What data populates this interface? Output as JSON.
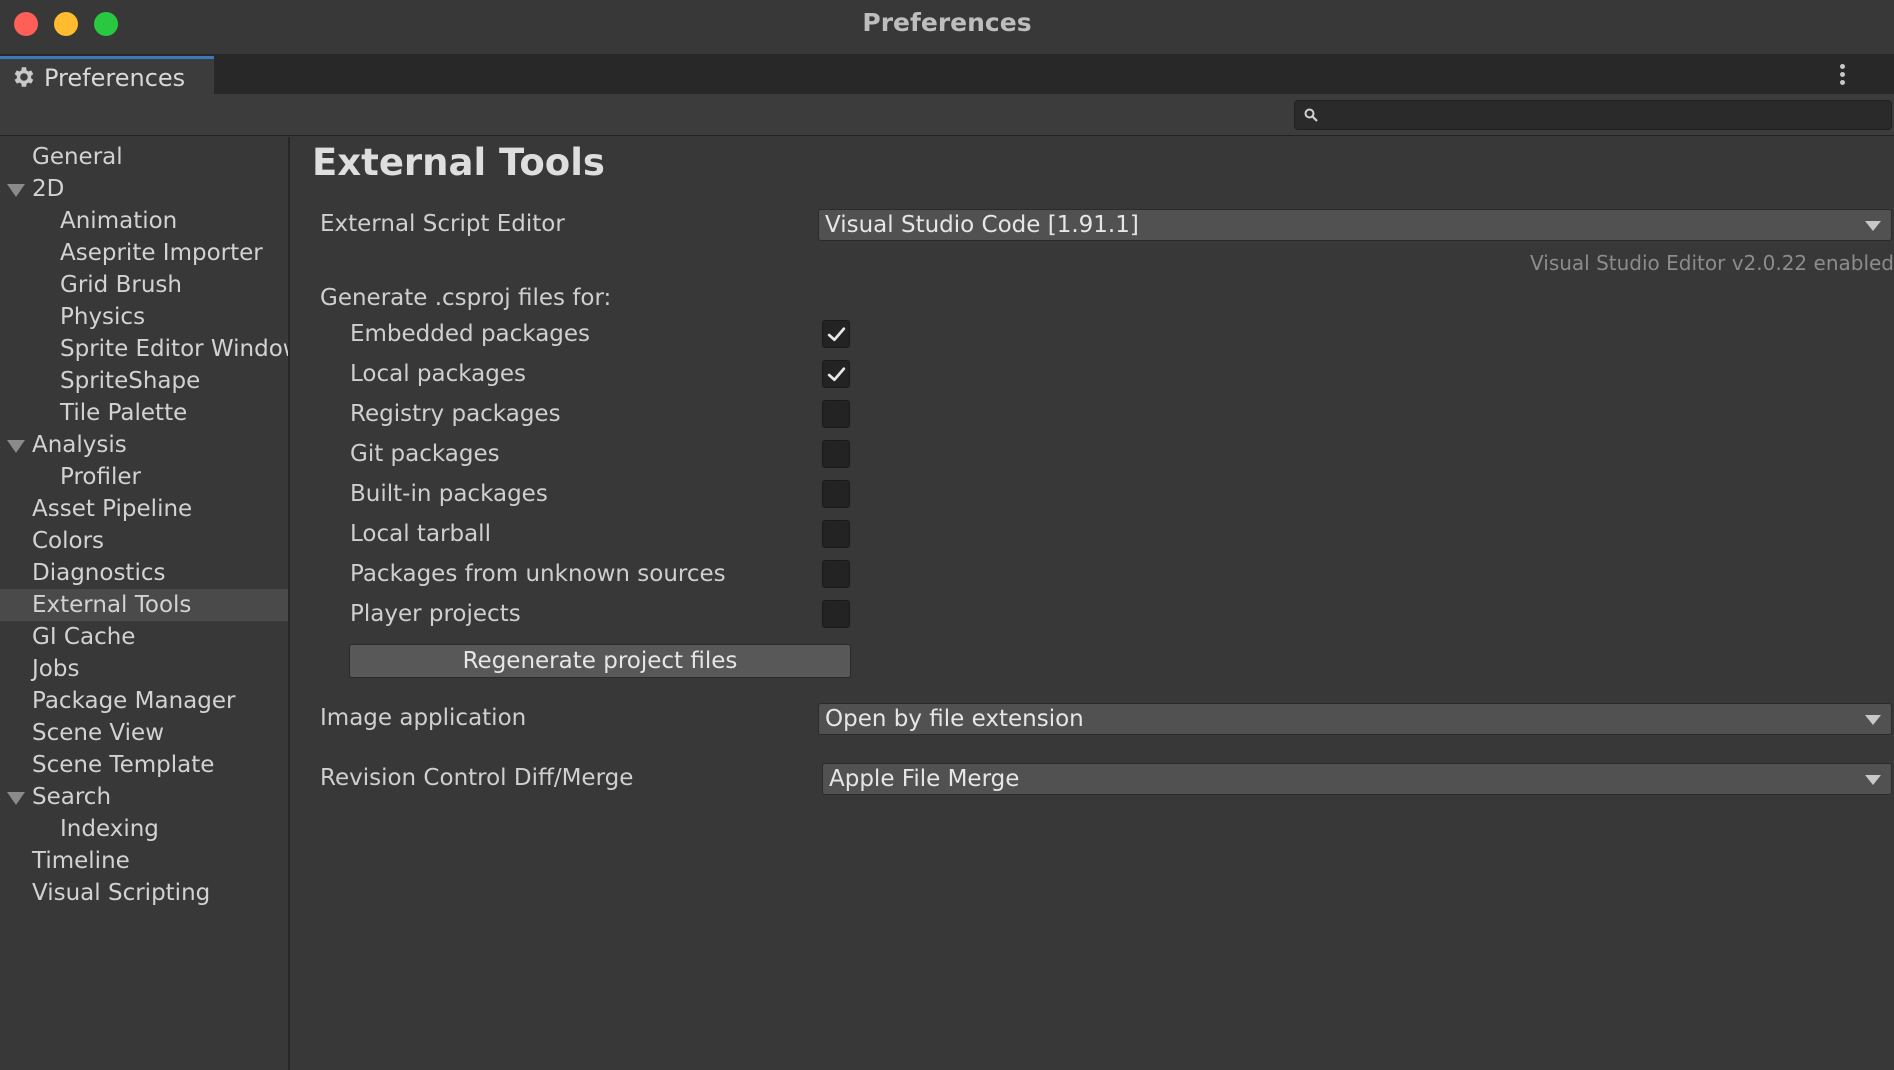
{
  "window": {
    "title": "Preferences"
  },
  "tab": {
    "label": "Preferences",
    "icon": "gear-icon"
  },
  "search": {
    "placeholder": "",
    "value": ""
  },
  "sidebar": {
    "selected": "External Tools",
    "items": [
      {
        "label": "General",
        "level": 0,
        "expandable": false
      },
      {
        "label": "2D",
        "level": 0,
        "expandable": true,
        "expanded": true
      },
      {
        "label": "Animation",
        "level": 1,
        "expandable": false
      },
      {
        "label": "Aseprite Importer",
        "level": 1,
        "expandable": false
      },
      {
        "label": "Grid Brush",
        "level": 1,
        "expandable": false
      },
      {
        "label": "Physics",
        "level": 1,
        "expandable": false
      },
      {
        "label": "Sprite Editor Window",
        "level": 1,
        "expandable": false
      },
      {
        "label": "SpriteShape",
        "level": 1,
        "expandable": false
      },
      {
        "label": "Tile Palette",
        "level": 1,
        "expandable": false
      },
      {
        "label": "Analysis",
        "level": 0,
        "expandable": true,
        "expanded": true
      },
      {
        "label": "Profiler",
        "level": 1,
        "expandable": false
      },
      {
        "label": "Asset Pipeline",
        "level": 0,
        "expandable": false
      },
      {
        "label": "Colors",
        "level": 0,
        "expandable": false
      },
      {
        "label": "Diagnostics",
        "level": 0,
        "expandable": false
      },
      {
        "label": "External Tools",
        "level": 0,
        "expandable": false
      },
      {
        "label": "GI Cache",
        "level": 0,
        "expandable": false
      },
      {
        "label": "Jobs",
        "level": 0,
        "expandable": false
      },
      {
        "label": "Package Manager",
        "level": 0,
        "expandable": false
      },
      {
        "label": "Scene View",
        "level": 0,
        "expandable": false
      },
      {
        "label": "Scene Template",
        "level": 0,
        "expandable": false
      },
      {
        "label": "Search",
        "level": 0,
        "expandable": true,
        "expanded": true
      },
      {
        "label": "Indexing",
        "level": 1,
        "expandable": false
      },
      {
        "label": "Timeline",
        "level": 0,
        "expandable": false
      },
      {
        "label": "Visual Scripting",
        "level": 0,
        "expandable": false
      }
    ]
  },
  "main": {
    "title": "External Tools",
    "script_editor": {
      "label": "External Script Editor",
      "value": "Visual Studio Code [1.91.1]",
      "hint": "Visual Studio Editor v2.0.22 enabled"
    },
    "csproj": {
      "heading": "Generate .csproj files for:",
      "options": [
        {
          "label": "Embedded packages",
          "checked": true
        },
        {
          "label": "Local packages",
          "checked": true
        },
        {
          "label": "Registry packages",
          "checked": false
        },
        {
          "label": "Git packages",
          "checked": false
        },
        {
          "label": "Built-in packages",
          "checked": false
        },
        {
          "label": "Local tarball",
          "checked": false
        },
        {
          "label": "Packages from unknown sources",
          "checked": false
        },
        {
          "label": "Player projects",
          "checked": false
        }
      ],
      "regenerate_label": "Regenerate project files"
    },
    "image_application": {
      "label": "Image application",
      "value": "Open by file extension"
    },
    "diff_merge": {
      "label": "Revision Control Diff/Merge",
      "value": "Apple File Merge"
    }
  }
}
